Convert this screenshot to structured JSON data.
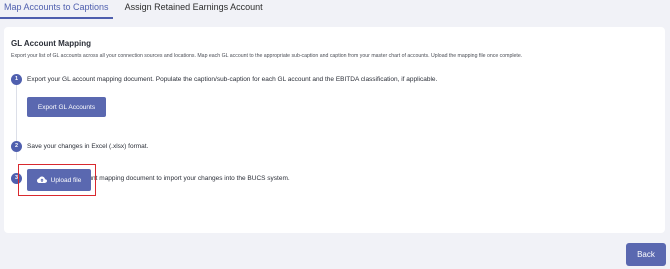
{
  "tabs": [
    {
      "label": "Map Accounts to Captions",
      "active": true
    },
    {
      "label": "Assign Retained Earnings Account",
      "active": false
    }
  ],
  "card": {
    "title": "GL Account Mapping",
    "description": "Export your list of GL accounts across all your connection sources and locations. Map each GL account to the appropriate sub-caption and caption from your master chart of accounts. Upload the mapping file once complete."
  },
  "steps": [
    {
      "number": "1",
      "text": "Export your GL account mapping document. Populate the caption/sub-caption for each GL account and the EBITDA classification, if applicable."
    },
    {
      "number": "2",
      "text": "Save your changes in Excel (.xlsx) format."
    },
    {
      "number": "3",
      "text": "Upload updated account mapping document to import your changes into the BUCS system."
    }
  ],
  "buttons": {
    "export_label": "Export GL Accounts",
    "upload_label": "Upload file",
    "back_label": "Back"
  },
  "icons": {
    "upload": "cloud-upload-icon"
  },
  "colors": {
    "accent": "#4f5fae",
    "button": "#5a68b0",
    "highlight": "#d9292f",
    "background": "#f1f2f7"
  }
}
